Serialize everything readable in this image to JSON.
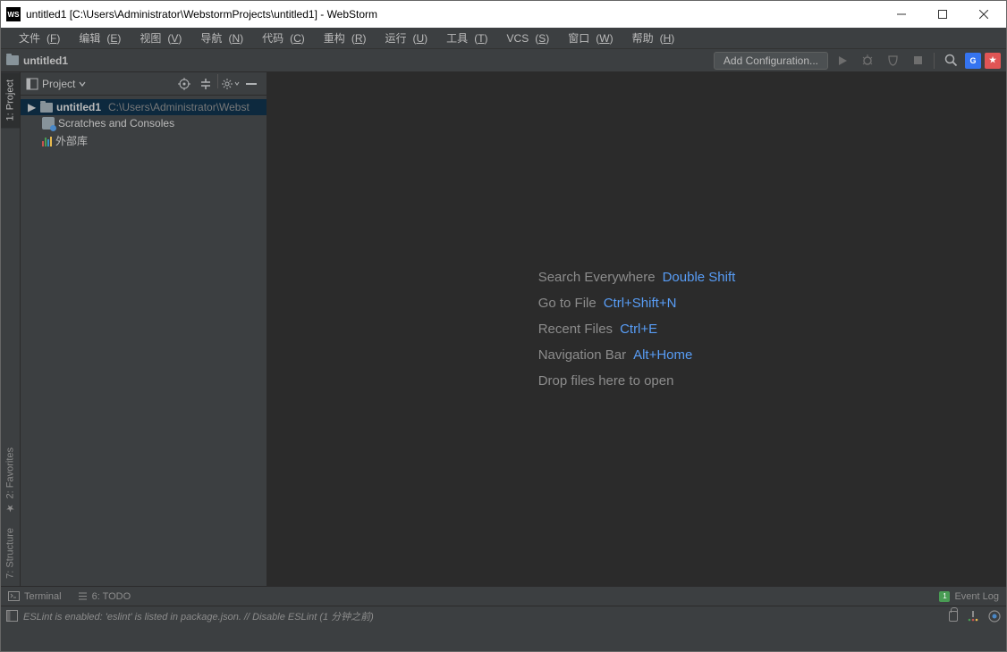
{
  "titlebar": {
    "app_icon_text": "WS",
    "title": "untitled1 [C:\\Users\\Administrator\\WebstormProjects\\untitled1] - WebStorm"
  },
  "menubar": {
    "items": [
      {
        "label": "文件",
        "u": "F"
      },
      {
        "label": "编辑",
        "u": "E"
      },
      {
        "label": "视图",
        "u": "V"
      },
      {
        "label": "导航",
        "u": "N"
      },
      {
        "label": "代码",
        "u": "C"
      },
      {
        "label": "重构",
        "u": "R"
      },
      {
        "label": "运行",
        "u": "U"
      },
      {
        "label": "工具",
        "u": "T"
      },
      {
        "label": "VCS",
        "u": "S"
      },
      {
        "label": "窗口",
        "u": "W"
      },
      {
        "label": "帮助",
        "u": "H"
      }
    ]
  },
  "navbar": {
    "breadcrumb": "untitled1",
    "add_configuration": "Add Configuration..."
  },
  "left_gutter": {
    "project_label": "1: Project",
    "favorites_label": "2: Favorites",
    "structure_label": "7: Structure"
  },
  "sidebar": {
    "header_label": "Project",
    "tree": {
      "root": {
        "name": "untitled1",
        "path": "C:\\Users\\Administrator\\Webst"
      },
      "scratches": "Scratches and Consoles",
      "external": "外部库"
    }
  },
  "welcome": {
    "rows": [
      {
        "label": "Search Everywhere",
        "kb": "Double Shift"
      },
      {
        "label": "Go to File",
        "kb": "Ctrl+Shift+N"
      },
      {
        "label": "Recent Files",
        "kb": "Ctrl+E"
      },
      {
        "label": "Navigation Bar",
        "kb": "Alt+Home"
      }
    ],
    "drop": "Drop files here to open"
  },
  "bottombar": {
    "terminal": "Terminal",
    "todo": "6: TODO",
    "event_log": "Event Log"
  },
  "statusbar": {
    "message": "ESLint is enabled: 'eslint' is listed in package.json. // Disable ESLint (1 分钟之前)"
  }
}
